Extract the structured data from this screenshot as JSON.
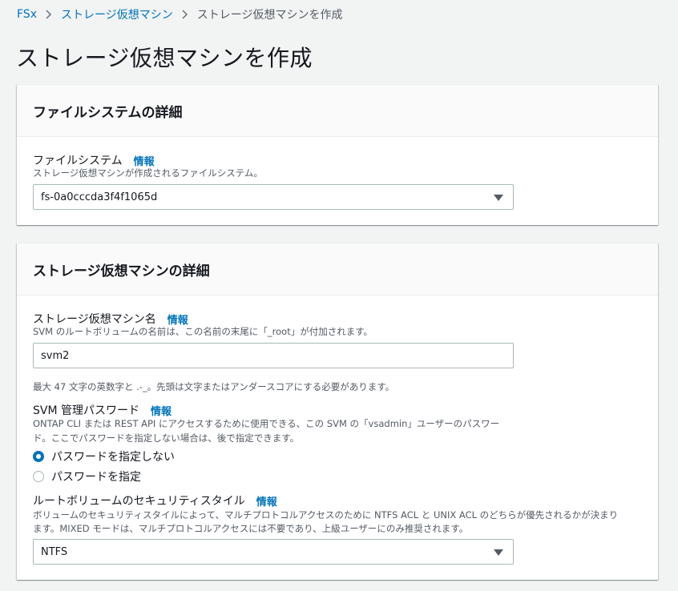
{
  "breadcrumb": {
    "items": [
      "FSx",
      "ストレージ仮想マシン"
    ],
    "current": "ストレージ仮想マシンを作成"
  },
  "page_title": "ストレージ仮想マシンを作成",
  "filesystem_panel": {
    "title": "ファイルシステムの詳細",
    "field_label": "ファイルシステム",
    "info": "情報",
    "description": "ストレージ仮想マシンが作成されるファイルシステム。",
    "selected_value": "fs-0a0cccda3f4f1065d"
  },
  "svm_panel": {
    "title": "ストレージ仮想マシンの詳細",
    "name_field": {
      "label": "ストレージ仮想マシン名",
      "info": "情報",
      "description": "SVM のルートボリュームの名前は、この名前の末尾に「_root」が付加されます。",
      "value": "svm2",
      "hint": "最大 47 文字の英数字と .-_。先頭は文字またはアンダースコアにする必要があります。"
    },
    "password_field": {
      "label": "SVM 管理パスワード",
      "info": "情報",
      "description_line1": "ONTAP CLI または REST API にアクセスするために使用できる、この SVM の「vsadmin」ユーザーのパスワー",
      "description_line2": "ド。ここでパスワードを指定しない場合は、後で指定できます。",
      "options": [
        "パスワードを指定しない",
        "パスワードを指定"
      ],
      "selected_index": 0
    },
    "security_field": {
      "label": "ルートボリュームのセキュリティスタイル",
      "info": "情報",
      "description_line1": "ボリュームのセキュリティスタイルによって、マルチプロトコルアクセスのために NTFS ACL と UNIX ACL のどちらが優先されるかが決まり",
      "description_line2": "ます。MIXED モードは、マルチプロトコルアクセスには不要であり、上級ユーザーにのみ推奨されます。",
      "selected_value": "NTFS"
    }
  },
  "colors": {
    "link": "#0073bb",
    "background": "#f2f3f3",
    "radio_selected": "#0073bb"
  }
}
